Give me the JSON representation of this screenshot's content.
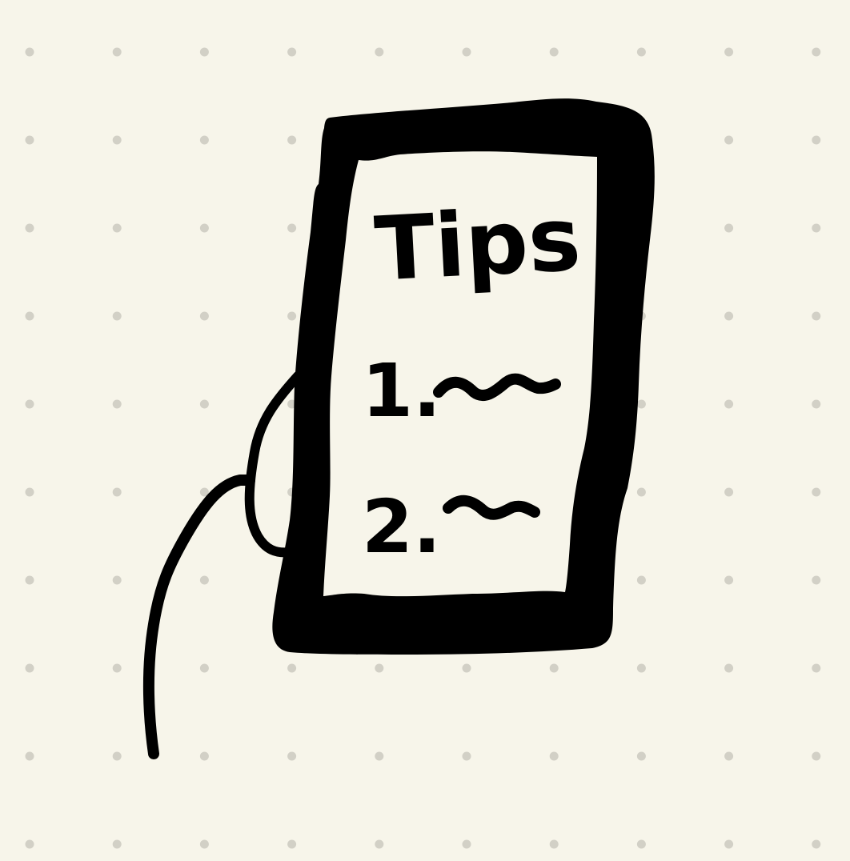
{
  "sketch": {
    "title": "Tips",
    "items": [
      {
        "number": "1."
      },
      {
        "number": "2."
      }
    ]
  },
  "colors": {
    "background": "#f7f5ea",
    "dot": "#d2d0c6",
    "ink": "#000000"
  }
}
